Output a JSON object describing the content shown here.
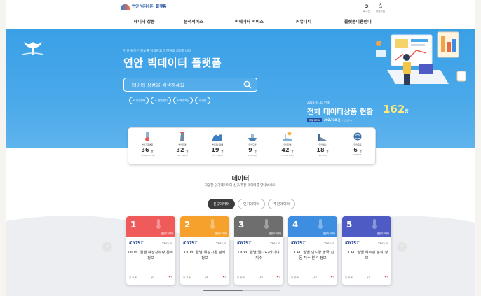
{
  "header": {
    "logo_text": "연안 빅데이터 플랫폼",
    "logo_sub": "",
    "nav": [
      "데이터 상품",
      "분석서비스",
      "빅데이터 서비스",
      "커뮤니티",
      "플랫폼이용안내"
    ],
    "login_label": "로그인",
    "join_label": "회원가입"
  },
  "hero": {
    "kicker": "연안에 모든 정보를 탐색하고 발견하고 공유합니다",
    "title": "연안 빅데이터 플랫폼",
    "search_placeholder": "데이터 상품을 검색하세요",
    "chips": [
      "# 기후변화",
      "# 연안침식",
      "# 해수욕장",
      "# 연안"
    ],
    "stat_date": "2023.04.10 현재",
    "stat_title": "전체 데이터상품 현황",
    "stat_number": "162",
    "stat_unit": "종",
    "stat_badge": "파일 DATA",
    "stat_data": "202,718 건",
    "stat_small": "(연안분석)"
  },
  "categories": [
    {
      "icon": "thermometer-icon",
      "name": "연안기후변화",
      "count": "36",
      "unit": "종",
      "file": "FILE 366,2511건"
    },
    {
      "icon": "lighthouse-icon",
      "name": "연안환경",
      "count": "32",
      "unit": "종",
      "file": "FILE 1,964건"
    },
    {
      "icon": "wave-icon",
      "name": "연안재난재해",
      "count": "19",
      "unit": "종",
      "file": "FILE 3,344건"
    },
    {
      "icon": "ship-icon",
      "name": "연안모형",
      "count": "9",
      "unit": "종",
      "file": "FILE 32건"
    },
    {
      "icon": "beach-icon",
      "name": "연안환경",
      "count": "42",
      "unit": "종",
      "file": "FILE 18,791건"
    },
    {
      "icon": "port-icon",
      "name": "연안해사",
      "count": "18",
      "unit": "종",
      "file": "FILE 806건"
    },
    {
      "icon": "globe-icon",
      "name": "연안공동",
      "count": "6",
      "unit": "종",
      "file": "FILE 395"
    }
  ],
  "section": {
    "title": "데이터",
    "subtitle": "다양한 인기데이터와 신규/추천 데이터를 만나보세요!",
    "tabs": [
      "신규데이터",
      "인기데이터",
      "추천데이터"
    ]
  },
  "cards": [
    {
      "num": "1",
      "color": "#ef5a5a",
      "tag": "연안기후변화",
      "org": "KIOST",
      "date": "23.03.21",
      "title": "OCPC 월별 해상강수량 분석 정보",
      "type": "무료",
      "downloads": "0",
      "likes": "0"
    },
    {
      "num": "2",
      "color": "#f5a12b",
      "tag": "연안기후변화",
      "org": "KIOST",
      "date": "23.03.21",
      "title": "OCPC 월별 해상기온 분석 정보",
      "type": "무료",
      "downloads": "4",
      "likes": "0"
    },
    {
      "num": "3",
      "color": "#6e6e6e",
      "tag": "연안기후변화",
      "org": "KIOST",
      "date": "23.03.21",
      "title": "OCPC 월별 엘니뇨/라니냐 지수",
      "type": "무료",
      "downloads": "16",
      "likes": "1"
    },
    {
      "num": "4",
      "color": "#3d8ee0",
      "tag": "연안기후변화",
      "org": "KIOST",
      "date": "23.03.21",
      "title": "OCPC 월별 인도양 쌍극 진동 지수 분석 정보",
      "type": "무료",
      "downloads": "15",
      "likes": "1"
    },
    {
      "num": "5",
      "color": "#4f5bc4",
      "tag": "연안기후변화",
      "org": "KIOST",
      "date": "23.03.21",
      "title": "OCPC 월별 해수면 분석 정보",
      "type": "무료",
      "downloads": "3",
      "likes": "0"
    }
  ],
  "colors": {
    "hero": "#3aa0e6",
    "accent": "#ffe87a",
    "navy": "#1f4e9c"
  }
}
